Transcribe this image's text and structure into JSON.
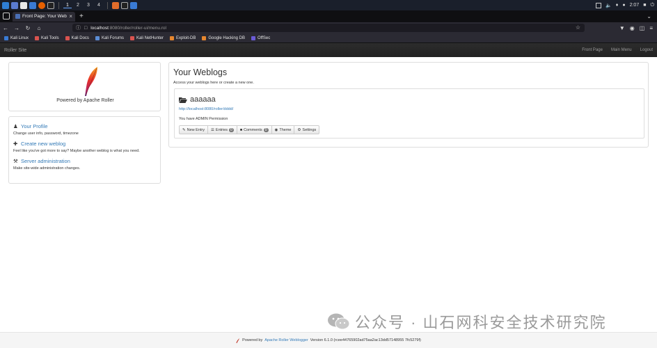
{
  "taskbar": {
    "workspaces": [
      "1",
      "2",
      "3",
      "4"
    ],
    "clock": "2:07"
  },
  "browser": {
    "tab_title": "Front Page: Your Weblogs",
    "tab_close": "×",
    "new_tab": "+",
    "url_host": "localhost",
    "url_path": ":8080/roller/roller-ui/menu.rol",
    "bookmarks": [
      "Kali Linux",
      "Kali Tools",
      "Kali Docs",
      "Kali Forums",
      "Kali NetHunter",
      "Exploit-DB",
      "Google Hacking DB",
      "OffSec"
    ]
  },
  "roller_nav": {
    "brand": "Roller Site",
    "links": [
      "Front Page",
      "Main Menu",
      "Logout"
    ]
  },
  "logo_panel": {
    "powered_by": "Powered by Apache Roller"
  },
  "actions": [
    {
      "title": "Your Profile",
      "desc": "Change user info, password, timezone",
      "icon": "user-icon"
    },
    {
      "title": "Create new weblog",
      "desc": "Feel like you've got more to say? Maybe another weblog is what you need.",
      "icon": "plus-icon"
    },
    {
      "title": "Server administration",
      "desc": "Make site-wide administration changes.",
      "icon": "wrench-icon"
    }
  ],
  "weblogs": {
    "heading": "Your Weblogs",
    "subtitle": "Access your weblogs here or create a new one.",
    "blog": {
      "name": "aaaaaa",
      "url": "http://localhost:8080/roller/dddd/",
      "permission": "You have ADMIN Permission",
      "buttons": {
        "new_entry": "New Entry",
        "entries": "Entries",
        "entries_count": "0",
        "comments": "Comments",
        "comments_count": "0",
        "theme": "Theme",
        "settings": "Settings"
      }
    }
  },
  "watermark": "公众号 · 山石网科安全技术研究院",
  "footer": {
    "prefix": "Powered by",
    "link": "Apache Roller Weblogger",
    "suffix": "Version 6.1.0 (rcee44765902ad75aa2ac13dd57148955 7fc5279f)"
  },
  "colors": {
    "link": "#337ab7",
    "navbar_bg": "#222222",
    "taskbar_bg": "#1a1f2b",
    "browser_bg": "#2b2a33"
  }
}
